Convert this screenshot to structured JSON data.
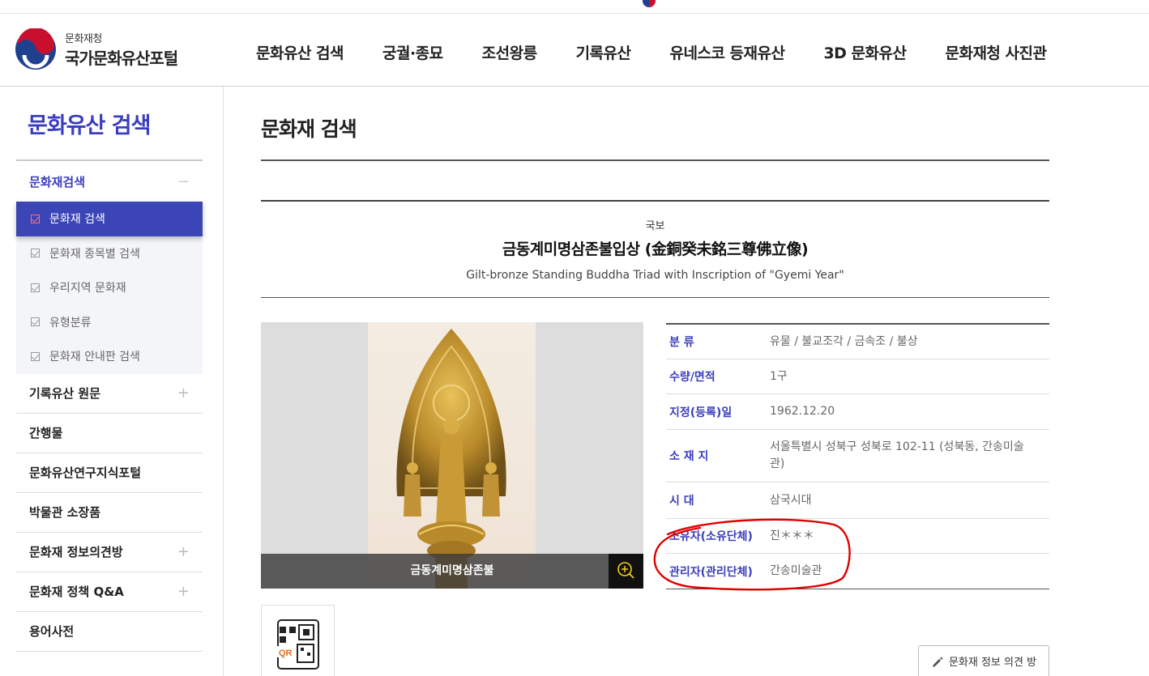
{
  "header": {
    "org": "문화재청",
    "portal": "국가문화유산포털",
    "nav": [
      "문화유산 검색",
      "궁궐·종묘",
      "조선왕릉",
      "기록유산",
      "유네스코 등재유산",
      "3D 문화유산",
      "문화재청 사진관"
    ]
  },
  "sidebar": {
    "title": "문화유산 검색",
    "group_label": "문화재검색",
    "group_toggle": "−",
    "sub_items": [
      "문화재 검색",
      "문화재 종목별 검색",
      "우리지역 문화재",
      "유형분류",
      "문화재 안내판 검색"
    ],
    "rows": [
      {
        "label": "기록유산 원문",
        "toggle": "+"
      },
      {
        "label": "간행물",
        "toggle": ""
      },
      {
        "label": "문화유산연구지식포털",
        "toggle": ""
      },
      {
        "label": "박물관 소장품",
        "toggle": ""
      },
      {
        "label": "문화재 정보의견방",
        "toggle": "+"
      },
      {
        "label": "문화재 정책 Q&A",
        "toggle": "+"
      },
      {
        "label": "용어사전",
        "toggle": ""
      }
    ]
  },
  "main": {
    "page_title": "문화재 검색",
    "category": "국보",
    "name_ko": "금동계미명삼존불입상 (金銅癸未銘三尊佛立像)",
    "name_en": "Gilt-bronze Standing Buddha Triad with Inscription of \"Gyemi Year\"",
    "image_caption": "금동계미명삼존불",
    "info": [
      {
        "label": "분 류",
        "value": "유물 / 불교조각 / 금속조 / 불상"
      },
      {
        "label": "수량/면적",
        "value": "1구"
      },
      {
        "label": "지정(등록)일",
        "value": "1962.12.20"
      },
      {
        "label": "소 재 지",
        "value": "서울특별시 성북구 성북로 102-11 (성북동, 간송미술관)"
      },
      {
        "label": "시 대",
        "value": "삼국시대"
      },
      {
        "label": "소유자(소유단체)",
        "value": "진＊＊＊"
      },
      {
        "label": "관리자(관리단체)",
        "value": "간송미술관"
      }
    ],
    "opinion_button": "문화재 정보 의견 방",
    "qr_label": "QR"
  },
  "colors": {
    "accent": "#3b3ebc",
    "active_bg": "#3b45b5",
    "highlight": "#f2d20a",
    "annotation": "#e00000"
  }
}
